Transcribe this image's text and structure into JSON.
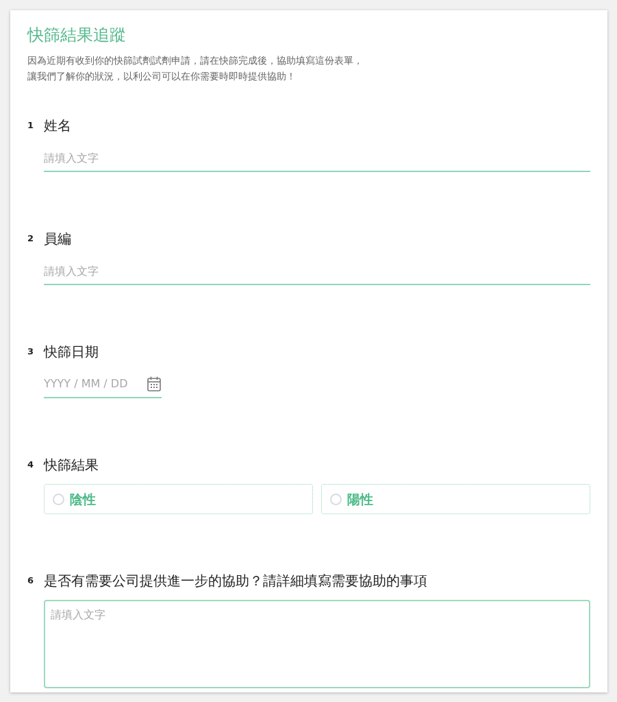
{
  "form": {
    "title": "快篩結果追蹤",
    "description": [
      "因為近期有收到你的快篩試劑試劑申請，請在快篩完成後，協助填寫這份表單，",
      "讓我們了解你的狀況，以利公司可以在你需要時即時提供協助！"
    ]
  },
  "questions": [
    {
      "number": "1",
      "label": "姓名",
      "kind": "text",
      "placeholder": "請填入文字"
    },
    {
      "number": "2",
      "label": "員編",
      "kind": "text",
      "placeholder": "請填入文字"
    },
    {
      "number": "3",
      "label": "快篩日期",
      "kind": "date",
      "placeholder": "YYYY / MM / DD"
    },
    {
      "number": "4",
      "label": "快篩結果",
      "kind": "radio",
      "options": [
        {
          "label": "陰性",
          "selected": false
        },
        {
          "label": "陽性",
          "selected": false
        }
      ]
    },
    {
      "number": "6",
      "label": "是否有需要公司提供進一步的協助？請詳細填寫需要協助的事項",
      "kind": "textarea",
      "placeholder": "請填入文字"
    }
  ]
}
